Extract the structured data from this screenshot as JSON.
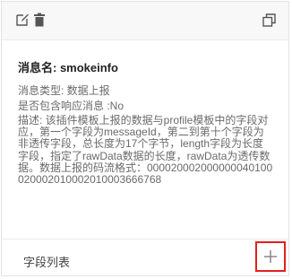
{
  "message": {
    "name_label": "消息名: smokeinfo",
    "type_line": "消息类型: 数据上报",
    "response_line": "是否包含响应消息 :No",
    "description": "描述: 该插件模板上报的数据与profile模板中的字段对应，第一个字段为messageId，第二到第十个字段为非透传字段，总长度为17个字节，length字段为长度字段，指定了rawData数据的长度，rawData为透传数据。数据上报的码流格式：000020002000000040100020002010002010003666768"
  },
  "footer": {
    "fields_label": "字段列表"
  },
  "icons": {
    "edit": "edit-icon",
    "delete": "trash-icon",
    "restore": "restore-window-icon",
    "add": "plus-icon"
  },
  "colors": {
    "highlight": "#e02020",
    "icon": "#555555"
  }
}
